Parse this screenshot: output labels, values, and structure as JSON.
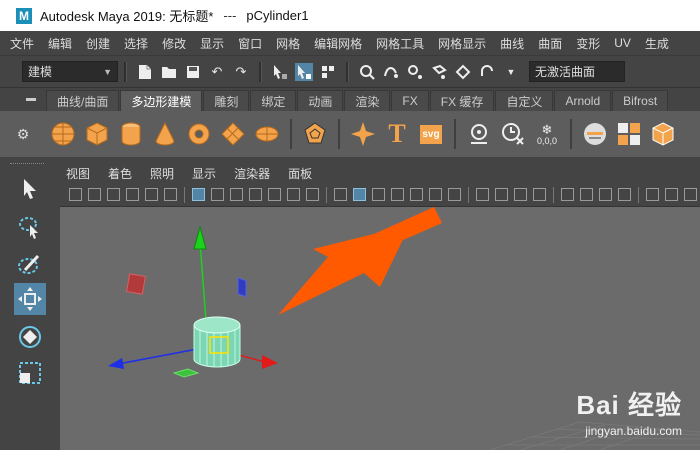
{
  "window": {
    "app_title": "Autodesk Maya 2019: 无标题*",
    "separator": "---",
    "object_name": "pCylinder1",
    "logo_letter": "M"
  },
  "menubar": [
    "文件",
    "编辑",
    "创建",
    "选择",
    "修改",
    "显示",
    "窗口",
    "网格",
    "编辑网格",
    "网格工具",
    "网格显示",
    "曲线",
    "曲面",
    "变形",
    "UV",
    "生成"
  ],
  "statusline": {
    "mode": "建模",
    "live_surface": "无激活曲面"
  },
  "shelf": {
    "tabs": [
      "曲线/曲面",
      "多边形建模",
      "雕刻",
      "绑定",
      "动画",
      "渲染",
      "FX",
      "FX 缓存",
      "自定义",
      "Arnold",
      "Bifrost"
    ],
    "active_tab": "多边形建模",
    "text_tool_label": "T",
    "svg_tool_label": "svg",
    "counter_label": "0,0,0"
  },
  "panel": {
    "menus": [
      "视图",
      "着色",
      "照明",
      "显示",
      "渲染器",
      "面板"
    ]
  },
  "watermark": {
    "brand": "Bai 经验",
    "url": "jingyan.baidu.com"
  },
  "colors": {
    "accent": "#5285a6",
    "arrow": "#ff5a00",
    "x_axis": "#e11a1a",
    "y_axis": "#1dd11d",
    "z_axis": "#1e2fe8",
    "cylinder": "#7bd6b4"
  }
}
